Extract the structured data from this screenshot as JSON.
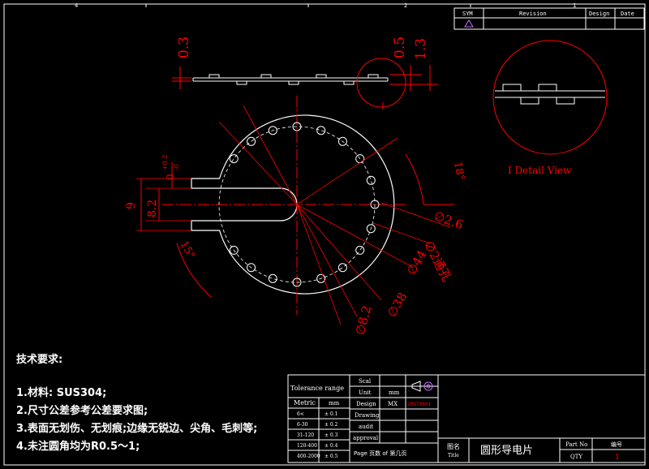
{
  "revision_block": {
    "headers": {
      "sym": "SYM",
      "revision": "Revision",
      "design": "Design",
      "date": "Date"
    }
  },
  "zone_marks": {
    "top_left": "4",
    "top_center": "2",
    "top_right": "1"
  },
  "side_view": {
    "dims": [
      "0.3",
      "0.5",
      "1.3"
    ],
    "detail_marker": "I"
  },
  "detail_view": {
    "caption": "I  Detail View"
  },
  "main_view": {
    "dims": {
      "width_outer": "9",
      "width_inner": "8.2",
      "tol_upper": "+0.2",
      "tol_base": "0",
      "tol_lower": "-0",
      "angle_top": "18°",
      "angle_bottom": "15°",
      "d_hole": "∅2.6",
      "through_hole": "∅2通孔",
      "d_outer": "∅44",
      "d_pitch": "∅38",
      "d_center": "∅8.2"
    }
  },
  "technical_requirements": {
    "heading": "技术要求:",
    "items": [
      "1.材料: SUS304;",
      "2.尺寸公差参考公差要求图;",
      "3.表面无划伤、无划痕;边缘无锐边、尖角、毛刺等;",
      "4.未注圆角均为R0.5～1;"
    ]
  },
  "tolerance_table": {
    "title": "Tolerance range",
    "col_headers": [
      "Metric",
      "mm"
    ],
    "rows": [
      [
        "6<",
        "± 0.1"
      ],
      [
        "6-30",
        "± 0.2"
      ],
      [
        "31-120",
        "± 0.3"
      ],
      [
        "120-400",
        "± 0.4"
      ],
      [
        "400-2000",
        "± 0.5"
      ]
    ]
  },
  "title_block": {
    "labels": [
      "Scal",
      "Unit",
      "Design",
      "Drawing",
      "audit",
      "approval"
    ],
    "unit_value": "mm",
    "design_value": "MX",
    "design_date": "20171001",
    "page_line": "Page  页数  of   第几页",
    "name_label_cn": "图名",
    "name_label_en": "Title",
    "part_name": "圆形导电片",
    "part_no_label": "Part No",
    "part_no_value_label": "编号",
    "qty_label": "QTY",
    "qty_value": "1"
  },
  "colors": {
    "background": "#000000",
    "line": "#ffffff",
    "dimension": "#ff0000",
    "centerline": "#ff0000",
    "hole_outline": "#ffffff"
  }
}
